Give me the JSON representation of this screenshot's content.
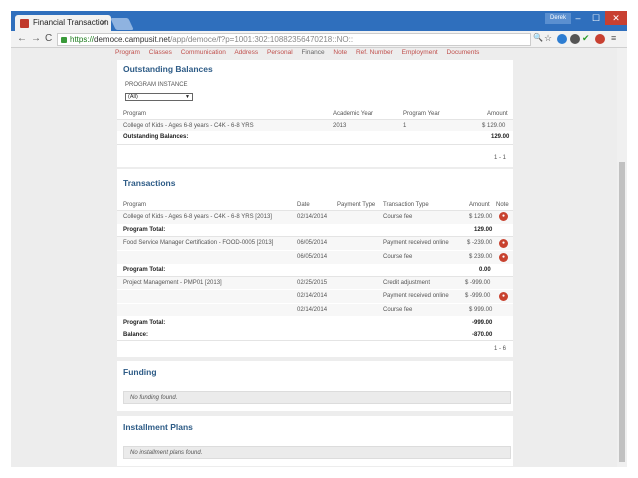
{
  "browser": {
    "tab_title": "Financial Transaction",
    "user_badge": "Derek",
    "url_scheme": "https://",
    "url_host": "democe.campusit.net",
    "url_path": "/app/democe/f?p=1001:302:10882356470218::NO::"
  },
  "nav_tabs": [
    "Program",
    "Classes",
    "Communication",
    "Address",
    "Personal",
    "Finance",
    "Note",
    "Ref. Number",
    "Employment",
    "Documents"
  ],
  "outstanding": {
    "title": "Outstanding Balances",
    "filter_label": "PROGRAM INSTANCE",
    "filter_value": "(All)",
    "headers": {
      "program": "Program",
      "academic_year": "Academic Year",
      "program_year": "Program Year",
      "amount": "Amount"
    },
    "row": {
      "program": "College of Kids - Ages 6-8 years - C4K - 6-8 YRS",
      "academic_year": "2013",
      "program_year": "1",
      "amount": "$ 129.00"
    },
    "total_label": "Outstanding Balances:",
    "total_value": "129.00",
    "pager": "1 - 1"
  },
  "transactions": {
    "title": "Transactions",
    "headers": {
      "program": "Program",
      "date": "Date",
      "payment_type": "Payment Type",
      "transaction_type": "Transaction Type",
      "amount": "Amount",
      "note": "Note"
    },
    "rows": [
      {
        "program": "College of Kids - Ages 6-8 years - C4K - 6-8 YRS [2013]",
        "date": "02/14/2014",
        "ttype": "Course fee",
        "amount": "$ 129.00"
      },
      {
        "program": "Program Total:",
        "amount": "129.00"
      },
      {
        "program": "Food Service Manager Certification - FOOD-0005 [2013]",
        "date": "06/05/2014",
        "ttype": "Payment received online",
        "amount": "$ -239.00"
      },
      {
        "program": "",
        "date": "06/05/2014",
        "ttype": "Course fee",
        "amount": "$ 239.00"
      },
      {
        "program": "Program Total:",
        "amount": "0.00"
      },
      {
        "program": "Project Management - PMP01 [2013]",
        "date": "02/25/2015",
        "ttype": "Credit adjustment",
        "amount": "$ -999.00"
      },
      {
        "program": "",
        "date": "02/14/2014",
        "ttype": "Payment received online",
        "amount": "$ -999.00"
      },
      {
        "program": "",
        "date": "02/14/2014",
        "ttype": "Course fee",
        "amount": "$ 999.00"
      },
      {
        "program": "Program Total:",
        "amount": "-999.00"
      },
      {
        "program": "Balance:",
        "amount": "-870.00"
      }
    ],
    "pager": "1 - 6"
  },
  "funding": {
    "title": "Funding",
    "empty": "No funding found."
  },
  "installments": {
    "title": "Installment Plans",
    "empty": "No installment plans found."
  },
  "colors": {
    "accent": "#2d5b86",
    "link": "#c0504d",
    "eye": "#c8422f"
  }
}
